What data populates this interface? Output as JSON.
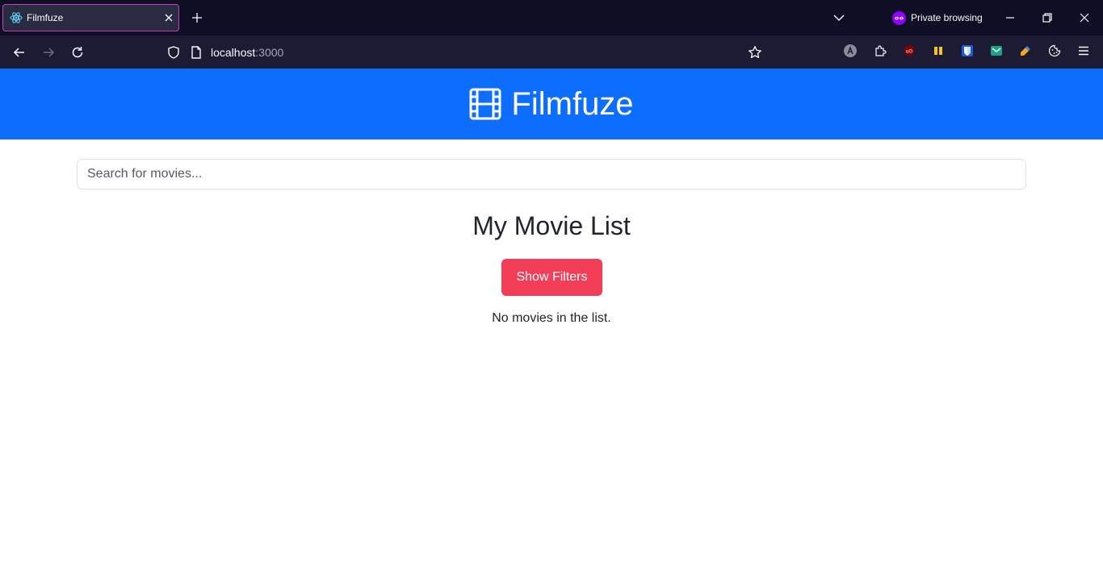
{
  "browser": {
    "tab_title": "Filmfuze",
    "private_label": "Private browsing",
    "url_host": "localhost",
    "url_port": ":3000"
  },
  "header": {
    "brand": "Filmfuze",
    "icon": "film-icon"
  },
  "search": {
    "placeholder": "Search for movies...",
    "value": ""
  },
  "main": {
    "title": "My Movie List",
    "filters_button_label": "Show Filters",
    "empty_message": "No movies in the list."
  },
  "colors": {
    "header_bg": "#0d6efd",
    "filters_button_bg": "#f33e57",
    "titlebar_bg": "#0f0e24",
    "navbar_bg": "#1c1b33"
  }
}
